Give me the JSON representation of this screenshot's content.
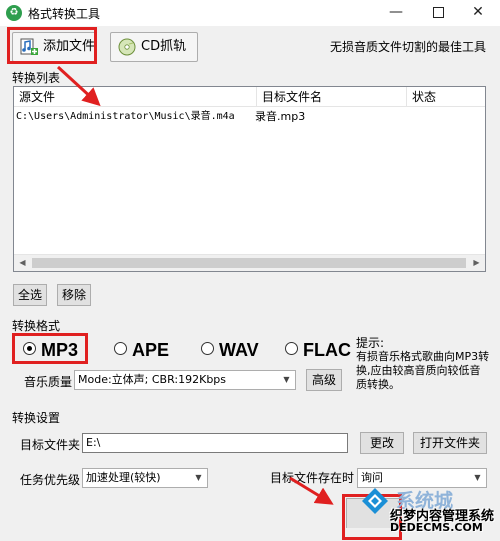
{
  "window": {
    "icon_glyph": "♻",
    "title": "格式转换工具",
    "min_glyph": "—",
    "close_glyph": "✕"
  },
  "toolbar": {
    "add_file_label": "添加文件",
    "cd_rip_label": "CD抓轨",
    "tagline": "无损音质文件切割的最佳工具"
  },
  "file_list": {
    "section_label": "转换列表",
    "columns": [
      "源文件",
      "目标文件名",
      "状态"
    ],
    "rows": [
      {
        "source": "C:\\Users\\Administrator\\Music\\录音.m4a",
        "target": "录音.mp3",
        "status": ""
      }
    ],
    "select_all_label": "全选",
    "remove_label": "移除"
  },
  "format": {
    "section_label": "转换格式",
    "options": [
      "MP3",
      "APE",
      "WAV",
      "FLAC"
    ],
    "selected": "MP3",
    "hint_title": "提示:",
    "hint_body": "有损音乐格式歌曲向MP3转换,应由较高音质向较低音质转换。",
    "quality_label": "音乐质量",
    "quality_value": "Mode:立体声; CBR:192Kbps",
    "advanced_label": "高级"
  },
  "settings": {
    "section_label": "转换设置",
    "target_folder_label": "目标文件夹",
    "target_folder_value": "E:\\",
    "change_label": "更改",
    "open_folder_label": "打开文件夹",
    "priority_label": "任务优先级",
    "priority_value": "加速处理(较快)",
    "exists_label": "目标文件存在时",
    "exists_value": "询问"
  },
  "watermark": {
    "line1": "系统城",
    "line2": "织梦内容管理系统",
    "line3": "DEDECMS.COM"
  },
  "colors": {
    "highlight_red": "#e02020",
    "window_bg": "#f0f0f0",
    "accent_green": "#2e9e4e"
  }
}
